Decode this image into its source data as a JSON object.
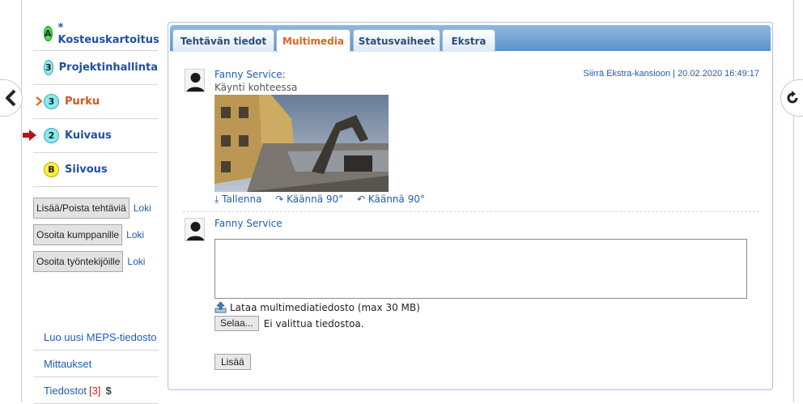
{
  "phases": [
    {
      "badge": "A",
      "label": "* Kosteuskartoitus",
      "badge_color": "green",
      "state": "normal"
    },
    {
      "badge": "3",
      "label": "Projektinhallinta",
      "badge_color": "cyan",
      "state": "normal"
    },
    {
      "badge": "3",
      "label": "Purku",
      "badge_color": "cyan",
      "state": "current"
    },
    {
      "badge": "2",
      "label": "Kuivaus",
      "badge_color": "cyan",
      "state": "next"
    },
    {
      "badge": "B",
      "label": "Siivous",
      "badge_color": "yellow",
      "state": "normal"
    }
  ],
  "actions": [
    {
      "button": "Lisää/Poista tehtäviä",
      "link": "Loki"
    },
    {
      "button": "Osoita kumppanille",
      "link": "Loki"
    },
    {
      "button": "Osoita työntekijöille",
      "link": "Loki"
    }
  ],
  "bottom_links": {
    "meps": "Luo uusi MEPS-tiedosto",
    "mittaukset": "Mittaukset",
    "tiedostot": "Tiedostot",
    "tiedostot_count": "[3]",
    "dollar": "$"
  },
  "tabs": [
    "Tehtävän tiedot",
    "Multimedia",
    "Statusvaiheet",
    "Ekstra"
  ],
  "active_tab": "Multimedia",
  "post": {
    "author": "Fanny Service:",
    "meta": "Siirrä Ekstra-kansioon | 20.02.2020 16:49:17",
    "description": "Käynti kohteessa",
    "actions": [
      "⤓ Tallenna",
      "↷ Käännä 90°",
      "↶ Käännä 90°"
    ]
  },
  "new_post": {
    "author": "Fanny Service",
    "comment_value": "",
    "upload_label": "Lataa multimediatiedosto (max 30 MB)",
    "browse_button": "Selaa...",
    "file_status": "Ei valittua tiedostoa.",
    "submit": "Lisää"
  },
  "colors": {
    "link": "#1f5bb8",
    "active_tab": "#e0641f",
    "current_phase": "#d9531e",
    "tabbar": "#6fa2d4",
    "count": "#c4221a"
  },
  "icons": {
    "left": "chevron-left-icon",
    "right": "refresh-icon",
    "upload": "upload-icon"
  }
}
